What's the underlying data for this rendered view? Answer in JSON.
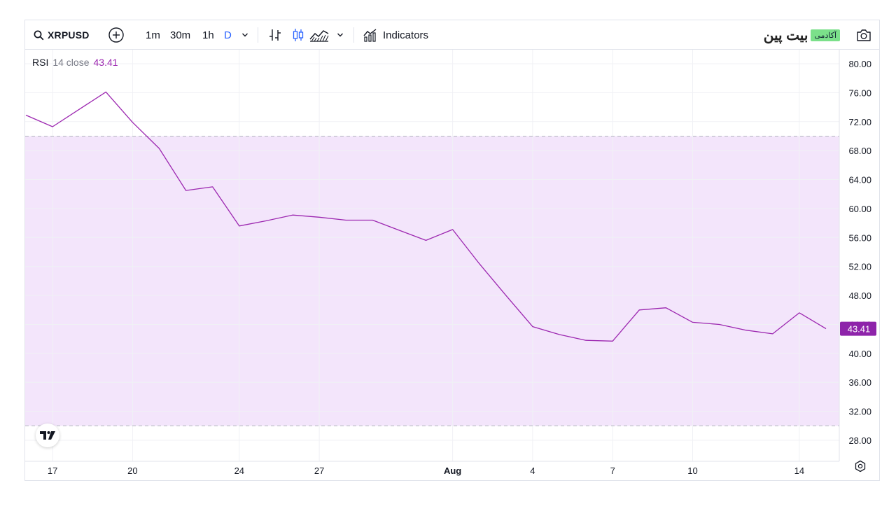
{
  "toolbar": {
    "symbol": "XRPUSD",
    "timeframes": [
      "1m",
      "30m",
      "1h",
      "D"
    ],
    "active_timeframe": "D",
    "indicators_label": "Indicators",
    "brand_name": "بیت پین",
    "brand_badge": "آکادمی",
    "icons": [
      "search-icon",
      "add-icon",
      "chevron-down-icon",
      "bar-chart-icon",
      "candles-icon",
      "area-chart-icon",
      "indicators-icon",
      "camera-icon",
      "tradingview-logo",
      "settings-icon"
    ]
  },
  "legend": {
    "indicator": "RSI",
    "params": "14 close",
    "value": "43.41"
  },
  "colors": {
    "line": "#9c27b0",
    "band_fill": "#f3e5fb",
    "accent_blue": "#2962ff",
    "value_badge": "#8e24aa"
  },
  "chart_data": {
    "type": "line",
    "title": "",
    "series": [
      {
        "name": "RSI",
        "x": [
          "Jul 16",
          "Jul 17",
          "Jul 18",
          "Jul 19",
          "Jul 20",
          "Jul 21",
          "Jul 22",
          "Jul 23",
          "Jul 24",
          "Jul 25",
          "Jul 26",
          "Jul 27",
          "Jul 28",
          "Jul 29",
          "Jul 30",
          "Jul 31",
          "Aug 1",
          "Aug 2",
          "Aug 3",
          "Aug 4",
          "Aug 5",
          "Aug 6",
          "Aug 7",
          "Aug 8",
          "Aug 9",
          "Aug 10",
          "Aug 11",
          "Aug 12",
          "Aug 13",
          "Aug 14",
          "Aug 15"
        ],
        "values": [
          72.9,
          71.3,
          73.7,
          76.1,
          71.9,
          68.3,
          62.5,
          63.0,
          57.6,
          58.3,
          59.1,
          58.8,
          58.4,
          58.4,
          57.0,
          55.6,
          57.1,
          52.4,
          48.0,
          43.7,
          42.6,
          41.8,
          41.7,
          46.0,
          46.3,
          44.3,
          44.0,
          43.2,
          42.7,
          45.6,
          43.41
        ]
      }
    ],
    "x_tick_labels": [
      {
        "index": 1,
        "label": "17"
      },
      {
        "index": 4,
        "label": "20"
      },
      {
        "index": 8,
        "label": "24"
      },
      {
        "index": 11,
        "label": "27"
      },
      {
        "index": 16,
        "label": "Aug"
      },
      {
        "index": 19,
        "label": "4"
      },
      {
        "index": 22,
        "label": "7"
      },
      {
        "index": 25,
        "label": "10"
      },
      {
        "index": 29,
        "label": "14"
      }
    ],
    "y_ticks": [
      "80.00",
      "76.00",
      "72.00",
      "68.00",
      "64.00",
      "60.00",
      "56.00",
      "52.00",
      "48.00",
      "44.00",
      "40.00",
      "36.00",
      "32.00",
      "28.00"
    ],
    "ylim": [
      25.5,
      81.8
    ],
    "bands": {
      "upper": 70,
      "lower": 30
    },
    "last_value_label": "43.41",
    "grid": true
  }
}
